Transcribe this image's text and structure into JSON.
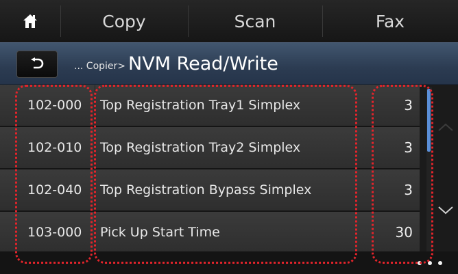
{
  "topbar": {
    "home_icon": "home-icon",
    "tabs": [
      {
        "label": "Copy"
      },
      {
        "label": "Scan"
      },
      {
        "label": "Fax"
      }
    ]
  },
  "header": {
    "back_icon": "back-arrow-icon",
    "breadcrumb_prefix": "... Copier>",
    "title": "NVM Read/Write"
  },
  "rows": [
    {
      "code": "102-000",
      "name": "Top Registration Tray1 Simplex",
      "value": "3"
    },
    {
      "code": "102-010",
      "name": "Top Registration Tray2 Simplex",
      "value": "3"
    },
    {
      "code": "102-040",
      "name": "Top Registration Bypass Simplex",
      "value": "3"
    },
    {
      "code": "103-000",
      "name": "Pick Up Start Time",
      "value": "30"
    }
  ],
  "colors": {
    "header_accent": "#3a4f69",
    "scroll_thumb": "#5b8fd8",
    "highlight": "#e3242b"
  }
}
